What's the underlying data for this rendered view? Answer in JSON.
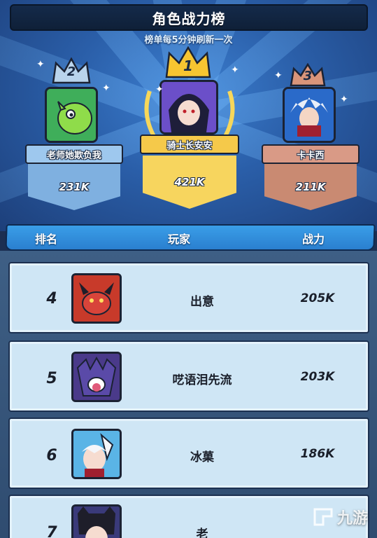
{
  "header": {
    "title": "角色战力榜",
    "subtitle": "榜单每5分钟刷新一次"
  },
  "podium": [
    {
      "rank": "2",
      "name": "老师她欺负我",
      "power": "231K",
      "crown_color": "#b9d4ec",
      "plate_color": "#9ec8ee",
      "avatar_bg": "#3fae5a"
    },
    {
      "rank": "1",
      "name": "骑士长安安",
      "power": "421K",
      "crown_color": "#f7c531",
      "plate_color": "#f5c94a",
      "avatar_bg": "#6b4fc9"
    },
    {
      "rank": "3",
      "name": "卡卡西",
      "power": "211K",
      "crown_color": "#d9957a",
      "plate_color": "#d99a86",
      "avatar_bg": "#2a6ac9"
    }
  ],
  "table": {
    "col_rank": "排名",
    "col_player": "玩家",
    "col_power": "战力"
  },
  "rows": [
    {
      "rank": "4",
      "name": "出意",
      "power": "205K",
      "avatar_bg": "#c83a2a"
    },
    {
      "rank": "5",
      "name": "呓语泪先流",
      "power": "203K",
      "avatar_bg": "#4a3a8a"
    },
    {
      "rank": "6",
      "name": "冰菓",
      "power": "186K",
      "avatar_bg": "#5ab4e6"
    },
    {
      "rank": "7",
      "name": "老",
      "power": "",
      "avatar_bg": "#3a3a7a"
    }
  ],
  "watermark": {
    "text": "九游"
  },
  "colors": {
    "accent_blue": "#2a7fcf",
    "row_bg": "#cfe6f5",
    "gold": "#f7c531"
  }
}
